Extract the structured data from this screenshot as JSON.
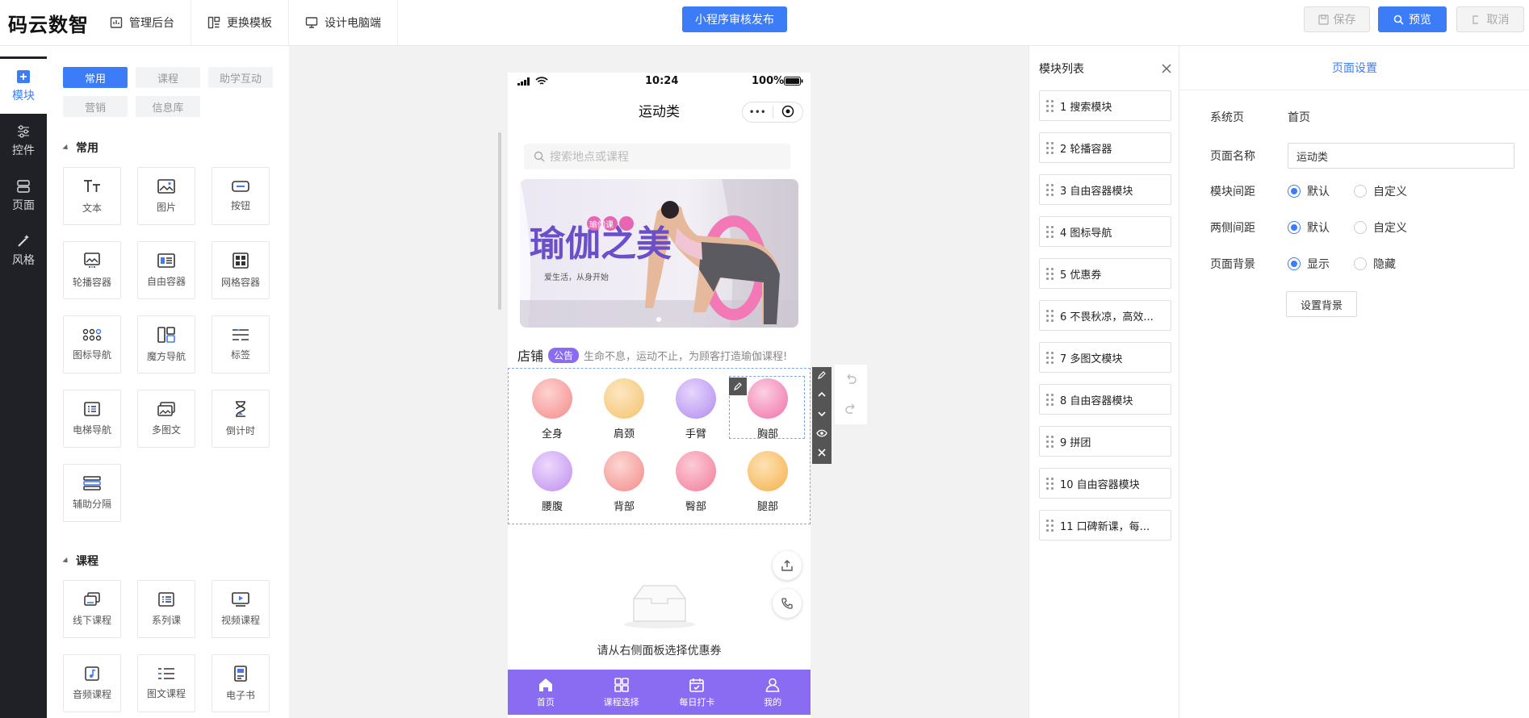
{
  "topbar": {
    "logo": "码云数智",
    "nav": [
      "管理后台",
      "更换模板",
      "设计电脑端"
    ],
    "publish": "小程序审核发布",
    "save": "保存",
    "preview": "预览",
    "cancel": "取消"
  },
  "sidebar": {
    "items": [
      {
        "label": "模块",
        "icon": "plus-square-icon",
        "active": true
      },
      {
        "label": "控件",
        "icon": "sliders-icon",
        "active": false
      },
      {
        "label": "页面",
        "icon": "page-icon",
        "active": false
      },
      {
        "label": "风格",
        "icon": "magic-wand-icon",
        "active": false
      }
    ]
  },
  "components": {
    "tabs": [
      "常用",
      "课程",
      "助学互动",
      "营销",
      "信息库"
    ],
    "sections": [
      {
        "title": "常用",
        "items": [
          "文本",
          "图片",
          "按钮",
          "轮播容器",
          "自由容器",
          "网格容器",
          "图标导航",
          "魔方导航",
          "标签",
          "电梯导航",
          "多图文",
          "倒计时",
          "辅助分隔"
        ]
      },
      {
        "title": "课程",
        "items": [
          "线下课程",
          "系列课",
          "视频课程",
          "音频课程",
          "图文课程",
          "电子书"
        ]
      }
    ]
  },
  "phone": {
    "time": "10:24",
    "battery": "100%",
    "title": "运动类",
    "search_placeholder": "搜索地点或课程",
    "banner": {
      "tag": "瑜伽课",
      "title": "瑜伽之美",
      "subtitle": "爱生活，从身开始"
    },
    "notice": {
      "shop": "店铺",
      "tag": "公告",
      "text": "生命不息，运动不止，为顾客打造瑜伽课程!"
    },
    "nav_items": [
      {
        "label": "全身",
        "color": "#f48a8a"
      },
      {
        "label": "肩颈",
        "color": "#f5c16b"
      },
      {
        "label": "手臂",
        "color": "#b28af0"
      },
      {
        "label": "胸部",
        "color": "#f06fa8"
      },
      {
        "label": "腰腹",
        "color": "#c08cf0"
      },
      {
        "label": "背部",
        "color": "#f38a86"
      },
      {
        "label": "臀部",
        "color": "#f27a9a"
      },
      {
        "label": "腿部",
        "color": "#f5b04a"
      }
    ],
    "empty_text": "请从右侧面板选择优惠券",
    "tabbar": [
      "首页",
      "课程选择",
      "每日打卡",
      "我的"
    ]
  },
  "module_list": {
    "title": "模块列表",
    "items": [
      "1 搜索模块",
      "2 轮播容器",
      "3 自由容器模块",
      "4 图标导航",
      "5 优惠券",
      "6 不畏秋凉，高效...",
      "7 多图文模块",
      "8 自由容器模块",
      "9 拼团",
      "10 自由容器模块",
      "11 口碑新课，每..."
    ]
  },
  "settings": {
    "tab": "页面设置",
    "system_page_label": "系统页",
    "system_page_value": "首页",
    "page_name_label": "页面名称",
    "page_name_value": "运动类",
    "module_gap_label": "模块间距",
    "side_gap_label": "两侧间距",
    "page_bg_label": "页面背景",
    "opt_default": "默认",
    "opt_custom": "自定义",
    "opt_show": "显示",
    "opt_hide": "隐藏",
    "set_bg_button": "设置背景"
  },
  "colors": {
    "accent": "#3d7cf7",
    "theme": "#8a6cf2",
    "sidebar": "#1f2127"
  }
}
